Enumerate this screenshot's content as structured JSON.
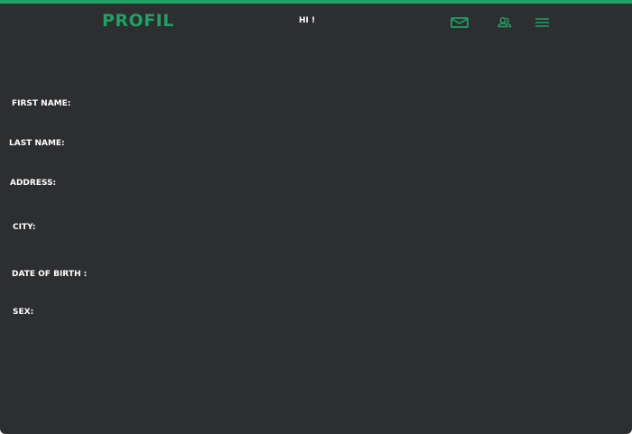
{
  "header": {
    "title": "PROFIL",
    "greeting": "HI !",
    "icons": [
      "mail-icon",
      "user-icon",
      "menu-icon"
    ],
    "accent_color": "#1fa065",
    "background_color": "#2d2e30"
  },
  "profile": {
    "first_name_label": "FIRST NAME:",
    "last_name_label": "LAST NAME:",
    "address_label": "ADDRESS:",
    "city_label": "CITY:",
    "dob_label": "DATE OF BIRTH :",
    "sex_label": "SEX:"
  }
}
